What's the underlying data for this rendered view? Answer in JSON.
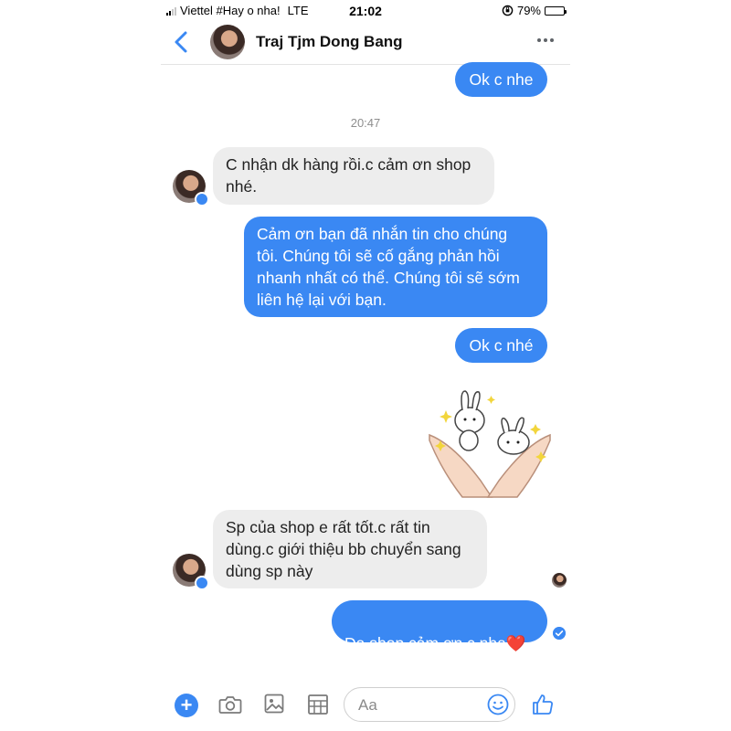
{
  "status_bar": {
    "carrier": "Viettel #Hay o nha!",
    "network": "LTE",
    "time": "21:02",
    "battery_percent": "79%",
    "battery_level": 0.79
  },
  "header": {
    "contact_name": "Traj Tjm Dong Bang",
    "icons": [
      "chevron-left-icon",
      "more-icon"
    ]
  },
  "colors": {
    "accent": "#3a88f3",
    "incoming_bubble": "#ededed",
    "timestamp": "#8e8e8e"
  },
  "chat": {
    "top_message": "Ok c nhe",
    "timestamp": "20:47",
    "incoming_1": "C nhận dk hàng rồi.c cảm ơn shop\nnhé.",
    "outgoing_auto_reply": "Cảm ơn bạn đã nhắn tin cho chúng\ntôi. Chúng tôi sẽ cố gắng phản hồi\nnhanh nhất có thể. Chúng tôi sẽ sớm\nliên hệ lại với bạn.",
    "outgoing_2": "Ok c nhé",
    "sticker": "bunny-sticker",
    "incoming_2": "Sp của shop e rất tốt.c rất tin\ndùng.c giới thiệu bb chuyển sang\ndùng sp này",
    "outgoing_3": "Dạ shop cảm ơn c nha",
    "heart_emoji": "❤️"
  },
  "composer": {
    "placeholder": "Aa",
    "icons": [
      "plus-icon",
      "camera-icon",
      "image-icon",
      "sticker-grid-icon",
      "emoji-icon",
      "like-icon"
    ]
  }
}
